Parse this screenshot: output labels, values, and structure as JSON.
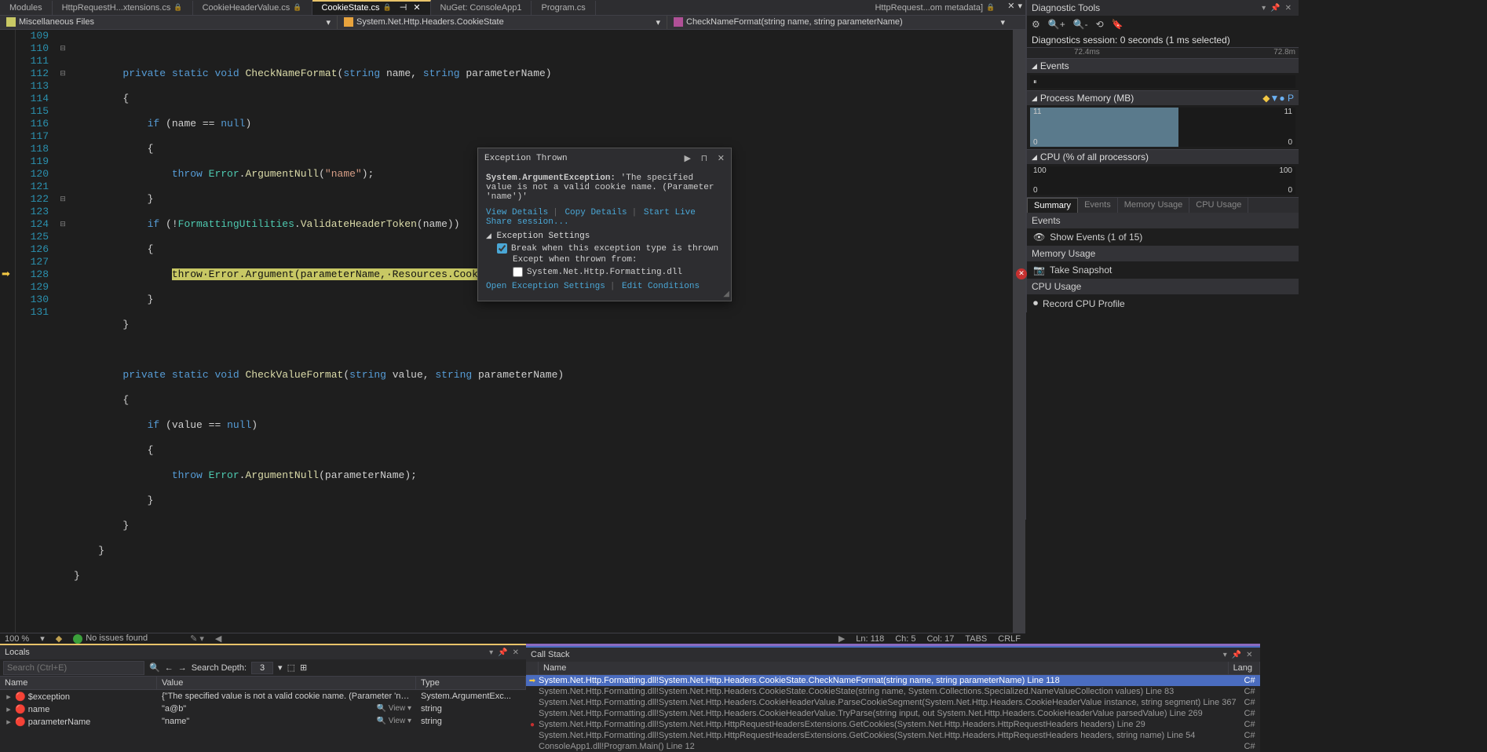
{
  "tabs": {
    "t0": "Modules",
    "t1": "HttpRequestH...xtensions.cs",
    "t2": "CookieHeaderValue.cs",
    "t3": "CookieState.cs",
    "t4": "NuGet: ConsoleApp1",
    "t5": "Program.cs",
    "right_tab": "HttpRequest...om metadata]"
  },
  "breadcrumb": {
    "b1": "Miscellaneous Files",
    "b2": "System.Net.Http.Headers.CookieState",
    "b3": "CheckNameFormat(string name, string parameterName)"
  },
  "status": {
    "zoom": "100 %",
    "issues": "No issues found",
    "ln": "Ln: 118",
    "ch": "Ch: 5",
    "col": "Col: 17",
    "tabs": "TABS",
    "crlf": "CRLF"
  },
  "exception": {
    "title": "Exception Thrown",
    "type": "System.ArgumentException:",
    "msg": "'The specified value is not a valid cookie name. (Parameter 'name')'",
    "view_details": "View Details",
    "copy_details": "Copy Details",
    "live_share": "Start Live Share session...",
    "settings_hdr": "Exception Settings",
    "chk1": "Break when this exception type is thrown",
    "except_label": "Except when thrown from:",
    "chk2": "System.Net.Http.Formatting.dll",
    "open_settings": "Open Exception Settings",
    "edit_cond": "Edit Conditions"
  },
  "locals": {
    "title": "Locals",
    "search_placeholder": "Search (Ctrl+E)",
    "depth_label": "Search Depth:",
    "depth_val": "3",
    "h1": "Name",
    "h2": "Value",
    "h3": "Type",
    "rows": [
      {
        "name": "$exception",
        "value": "{\"The specified value is not a valid cookie name. (Parameter 'name')\"}",
        "type": "System.ArgumentExc..."
      },
      {
        "name": "name",
        "value": "\"a@b\"",
        "type": "string",
        "view": true
      },
      {
        "name": "parameterName",
        "value": "\"name\"",
        "type": "string",
        "view": true
      }
    ]
  },
  "callstack": {
    "title": "Call Stack",
    "h1": "Name",
    "h2": "Lang",
    "rows": [
      {
        "marker": "arrow",
        "text": "System.Net.Http.Formatting.dll!System.Net.Http.Headers.CookieState.CheckNameFormat(string name, string parameterName) Line 118",
        "lang": "C#",
        "sel": true
      },
      {
        "text": "System.Net.Http.Formatting.dll!System.Net.Http.Headers.CookieState.CookieState(string name, System.Collections.Specialized.NameValueCollection values) Line 83",
        "lang": "C#"
      },
      {
        "text": "System.Net.Http.Formatting.dll!System.Net.Http.Headers.CookieHeaderValue.ParseCookieSegment(System.Net.Http.Headers.CookieHeaderValue instance, string segment) Line 367",
        "lang": "C#"
      },
      {
        "text": "System.Net.Http.Formatting.dll!System.Net.Http.Headers.CookieHeaderValue.TryParse(string input, out System.Net.Http.Headers.CookieHeaderValue parsedValue) Line 269",
        "lang": "C#"
      },
      {
        "marker": "bp",
        "text": "System.Net.Http.Formatting.dll!System.Net.Http.HttpRequestHeadersExtensions.GetCookies(System.Net.Http.Headers.HttpRequestHeaders headers) Line 29",
        "lang": "C#"
      },
      {
        "text": "System.Net.Http.Formatting.dll!System.Net.Http.HttpRequestHeadersExtensions.GetCookies(System.Net.Http.Headers.HttpRequestHeaders headers, string name) Line 54",
        "lang": "C#"
      },
      {
        "text": "ConsoleApp1.dll!Program.Main() Line 12",
        "lang": "C#"
      }
    ]
  },
  "diag": {
    "title": "Diagnostic Tools",
    "session": "Diagnostics session: 0 seconds (1 ms selected)",
    "t1": "72.4ms",
    "t2": "72.8m",
    "events_hdr": "Events",
    "mem_hdr": "Process Memory (MB)",
    "mem_max": "11",
    "mem_min": "0",
    "cpu_hdr": "CPU (% of all processors)",
    "cpu_max": "100",
    "cpu_min": "0",
    "tab_summary": "Summary",
    "tab_events": "Events",
    "tab_mem": "Memory Usage",
    "tab_cpu": "CPU Usage",
    "sec_events": "Events",
    "show_events": "Show Events (1 of 15)",
    "sec_mem": "Memory Usage",
    "take_snap": "Take Snapshot",
    "sec_cpu": "CPU Usage",
    "rec_cpu": "Record CPU Profile"
  },
  "code_lines": {
    "l109": "",
    "l110": "        private static void CheckNameFormat(string name, string parameterName)",
    "l111": "        {",
    "l112": "            if (name == null)",
    "l113": "            {",
    "l114": "                throw Error.ArgumentNull(\"name\");",
    "l115": "            }",
    "l116": "            if (!FormattingUtilities.ValidateHeaderToken(name))",
    "l117": "            {",
    "l118": "                throw·Error.Argument(parameterName,·Resources.CookieInvalidName);",
    "l119": "            }",
    "l120": "        }",
    "l121": "",
    "l122": "        private static void CheckValueFormat(string value, string parameterName)",
    "l123": "        {",
    "l124": "            if (value == null)",
    "l125": "            {",
    "l126": "                throw Error.ArgumentNull(parameterName);",
    "l127": "            }",
    "l128": "        }",
    "l129": "    }",
    "l130": "}",
    "l131": ""
  }
}
